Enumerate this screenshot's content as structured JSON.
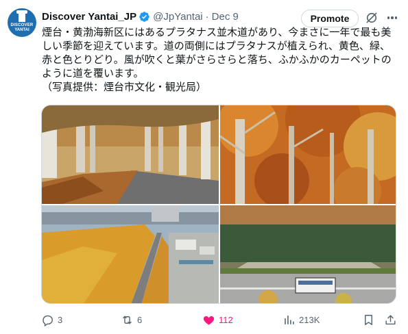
{
  "account": {
    "display_name": "Discover Yantai_JP",
    "handle": "@JpYantai",
    "separator": "·",
    "date": "Dec 9",
    "avatar_text_line1": "DISCOVER",
    "avatar_text_line2": "YANTAI",
    "verified_color": "#1d9bf0"
  },
  "header": {
    "promote_label": "Promote"
  },
  "post": {
    "lines": [
      "煙台・黄渤海新区にはあるプラタナス並木道があり、今まさに一年で最も美",
      "しい季節を迎えています。道の両側にはプラタナスが植えられ、黄色、緑、",
      "赤と色とりどり。風が吹くと葉がさらさらと落ち、ふかふかのカーペットの",
      "ように道を覆います。",
      "（写真提供：煙台市文化・観光局）"
    ]
  },
  "media": {
    "count": 4
  },
  "actions": {
    "reply_count": "3",
    "repost_count": "6",
    "like_count": "112",
    "views_count": "213K",
    "like_color": "#f91880"
  }
}
